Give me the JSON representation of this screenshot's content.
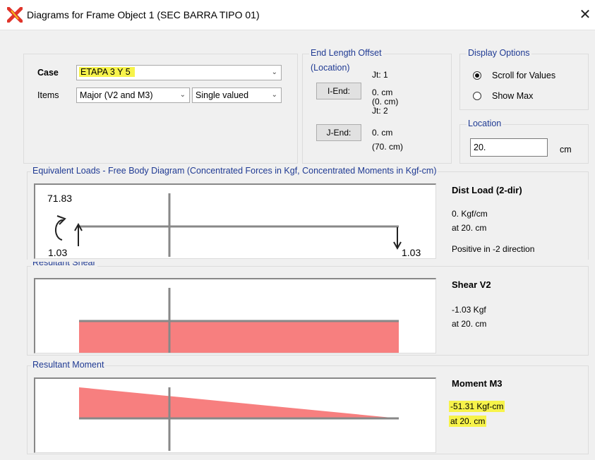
{
  "window": {
    "title": "Diagrams for Frame Object 1  (SEC BARRA TIPO 01)",
    "icon": "x-logo-icon",
    "close_glyph": "✕"
  },
  "case": {
    "label": "Case",
    "value": "ETAPA 3 Y 5",
    "items_label": "Items",
    "items_value": "Major (V2 and M3)",
    "valued_value": "Single valued"
  },
  "end_length_offset": {
    "title": "End Length Offset",
    "subtitle": "(Location)",
    "i_end_button": "I-End:",
    "j_end_button": "J-End:",
    "jt1": "Jt:  1",
    "i_value": "0. cm",
    "i_location": "(0. cm)",
    "jt2": "Jt:  2",
    "j_value": "0. cm",
    "j_location": "(70. cm)"
  },
  "display_options": {
    "title": "Display Options",
    "scroll": "Scroll for Values",
    "show_max": "Show Max",
    "selected": "scroll"
  },
  "location": {
    "title": "Location",
    "value": "20.",
    "unit": "cm"
  },
  "fbd": {
    "title": "Equivalent Loads - Free Body Diagram  (Concentrated Forces in Kgf, Concentrated Moments in Kgf-cm)",
    "moment_value": "71.83",
    "left_force": "1.03",
    "right_force": "1.03",
    "info_title": "Dist Load (2-dir)",
    "info_value": "0. Kgf/cm",
    "info_at": "at 20. cm",
    "info_note": "Positive in -2 direction"
  },
  "shear": {
    "title": "Resultant Shear",
    "info_title": "Shear V2",
    "info_value": "-1.03 Kgf",
    "info_at": "at 20. cm",
    "fill_color": "#f77f7f"
  },
  "moment": {
    "title": "Resultant Moment",
    "info_title": "Moment M3",
    "info_value": "-51.31 Kgf-cm",
    "info_at": "at 20. cm",
    "fill_color": "#f77f7f"
  },
  "colors": {
    "highlight": "#f7f34a",
    "group_title": "#1f3a93"
  }
}
